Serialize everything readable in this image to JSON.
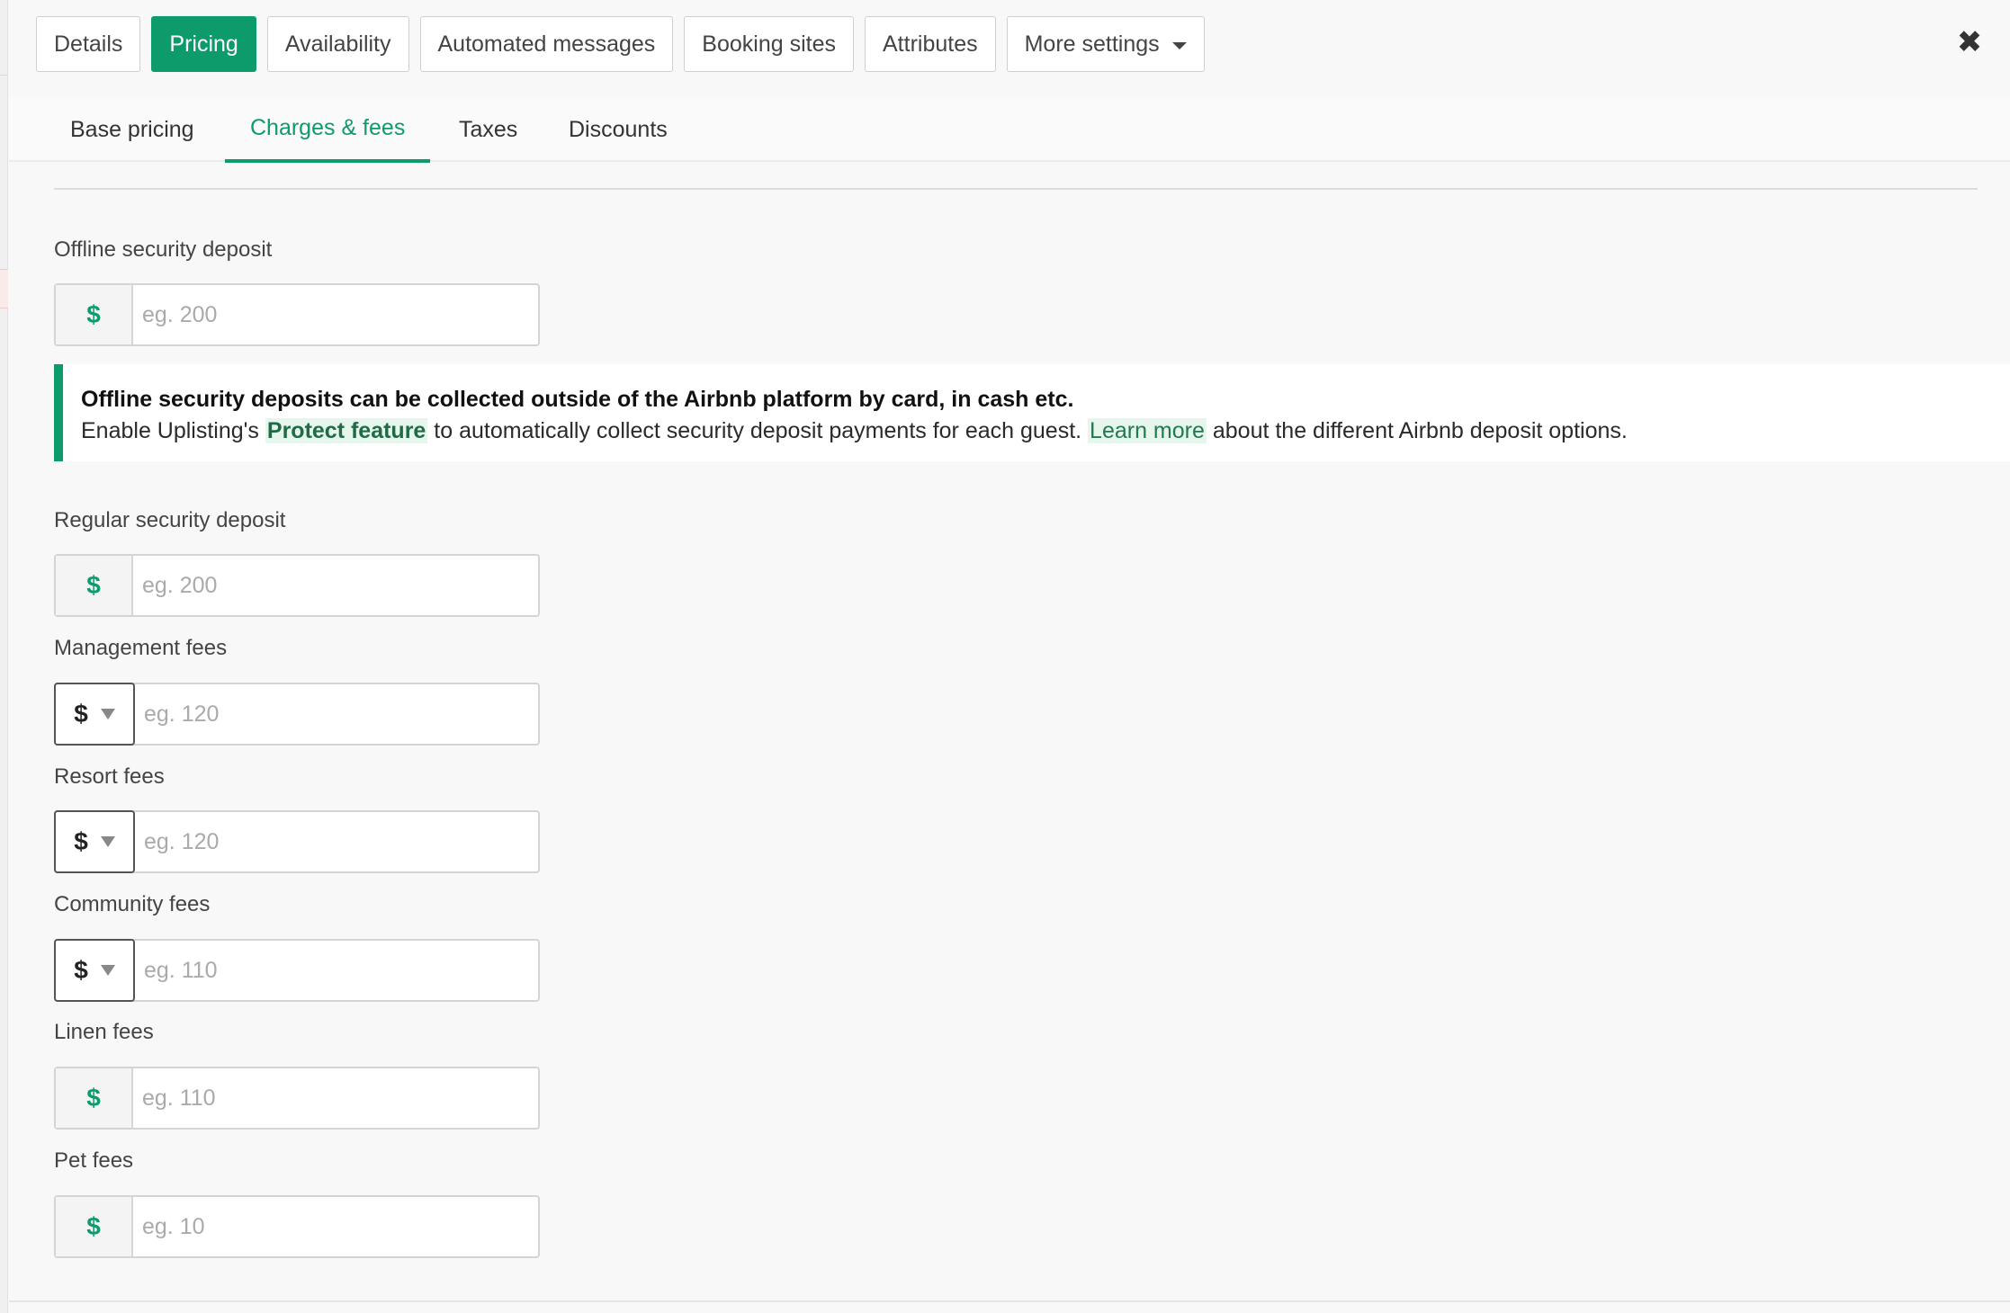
{
  "top_tabs": {
    "details": "Details",
    "pricing": "Pricing",
    "availability": "Availability",
    "automated_messages": "Automated messages",
    "booking_sites": "Booking sites",
    "attributes": "Attributes",
    "more_settings": "More settings"
  },
  "close_glyph": "✖",
  "sub_tabs": {
    "base_pricing": "Base pricing",
    "charges_fees": "Charges & fees",
    "taxes": "Taxes",
    "discounts": "Discounts"
  },
  "offline_deposit": {
    "label": "Offline security deposit",
    "currency": "$",
    "placeholder": "eg. 200"
  },
  "callout": {
    "headline": "Offline security deposits can be collected outside of the Airbnb platform by card, in cash etc.",
    "text_1": "Enable Uplisting's ",
    "protect_link": "Protect feature",
    "text_2": " to automatically collect security deposit payments for each guest. ",
    "learn_more": "Learn more",
    "text_3": " about the different Airbnb deposit options."
  },
  "regular_deposit": {
    "label": "Regular security deposit",
    "currency": "$",
    "placeholder": "eg. 200"
  },
  "management_fees": {
    "label": "Management fees",
    "unit": "$",
    "placeholder": "eg. 120"
  },
  "resort_fees": {
    "label": "Resort fees",
    "unit": "$",
    "placeholder": "eg. 120"
  },
  "community_fees": {
    "label": "Community fees",
    "unit": "$",
    "placeholder": "eg. 110"
  },
  "linen_fees": {
    "label": "Linen fees",
    "currency": "$",
    "placeholder": "eg. 110"
  },
  "pet_fees": {
    "label": "Pet fees",
    "currency": "$",
    "placeholder": "eg. 10"
  },
  "colors": {
    "accent": "#0e9b6b",
    "callout_highlight": "#e6f6ec"
  }
}
